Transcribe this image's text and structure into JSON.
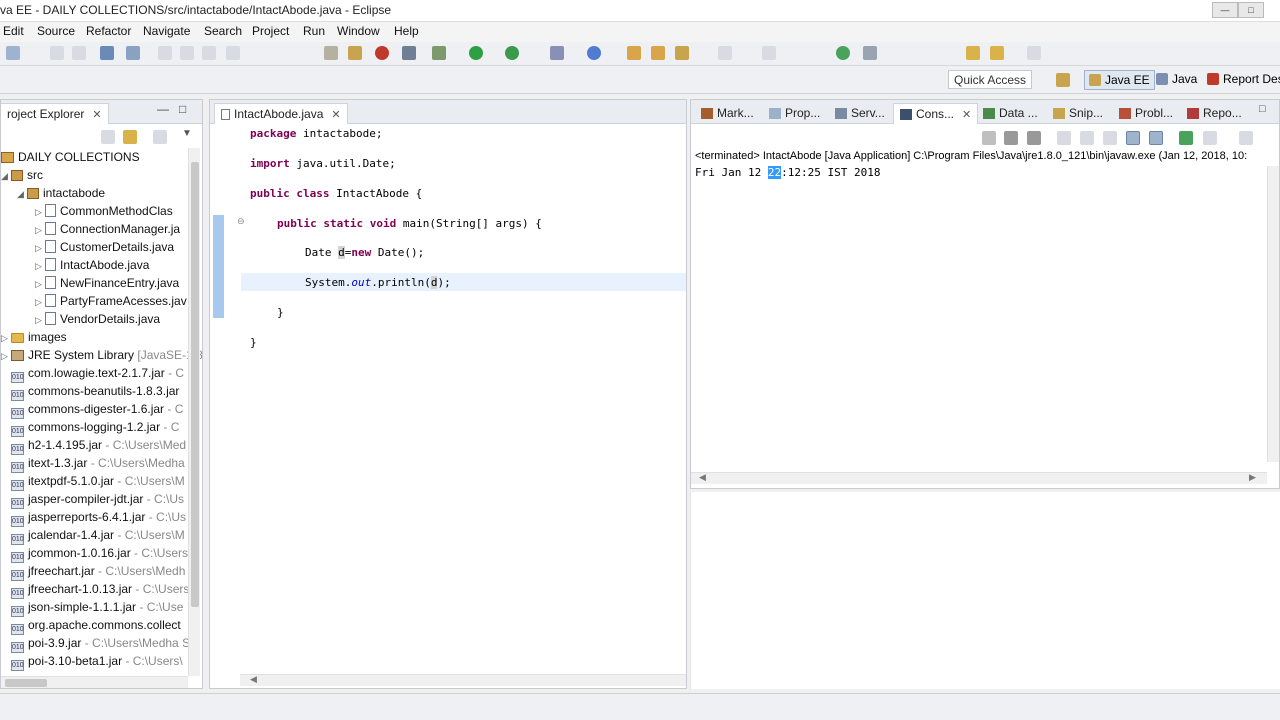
{
  "window": {
    "title": "va EE - DAILY COLLECTIONS/src/intactabode/IntactAbode.java - Eclipse"
  },
  "menu": [
    "Edit",
    "Source",
    "Refactor",
    "Navigate",
    "Search",
    "Project",
    "Run",
    "Window",
    "Help"
  ],
  "toolbar": {
    "quick_access": "Quick Access",
    "perspectives": [
      "Java EE",
      "Java",
      "Report Des"
    ]
  },
  "project_explorer": {
    "tab_label": "roject Explorer",
    "project": "DAILY COLLECTIONS",
    "src": "src",
    "package": "intactabode",
    "files": [
      "CommonMethodClas",
      "ConnectionManager.ja",
      "CustomerDetails.java",
      "IntactAbode.java",
      "NewFinanceEntry.java",
      "PartyFrameAcesses.jav",
      "VendorDetails.java"
    ],
    "images": "images",
    "jre": {
      "name": "JRE System Library",
      "path": "[JavaSE-1.8"
    },
    "jars": [
      {
        "name": "com.lowagie.text-2.1.7.jar",
        "path": " - C"
      },
      {
        "name": "commons-beanutils-1.8.3.jar",
        "path": ""
      },
      {
        "name": "commons-digester-1.6.jar",
        "path": " - C"
      },
      {
        "name": "commons-logging-1.2.jar",
        "path": " - C"
      },
      {
        "name": "h2-1.4.195.jar",
        "path": " - C:\\Users\\Med"
      },
      {
        "name": "itext-1.3.jar",
        "path": " - C:\\Users\\Medha"
      },
      {
        "name": "itextpdf-5.1.0.jar",
        "path": " - C:\\Users\\M"
      },
      {
        "name": "jasper-compiler-jdt.jar",
        "path": " - C:\\Us"
      },
      {
        "name": "jasperreports-6.4.1.jar",
        "path": " - C:\\Us"
      },
      {
        "name": "jcalendar-1.4.jar",
        "path": " - C:\\Users\\M"
      },
      {
        "name": "jcommon-1.0.16.jar",
        "path": " - C:\\Users"
      },
      {
        "name": "jfreechart.jar",
        "path": " - C:\\Users\\Medh"
      },
      {
        "name": "jfreechart-1.0.13.jar",
        "path": " - C:\\Users"
      },
      {
        "name": "json-simple-1.1.1.jar",
        "path": " - C:\\Use"
      },
      {
        "name": "org.apache.commons.collect",
        "path": ""
      },
      {
        "name": "poi-3.9.jar",
        "path": " - C:\\Users\\Medha S"
      },
      {
        "name": "poi-3.10-beta1.jar",
        "path": " - C:\\Users\\"
      }
    ]
  },
  "editor": {
    "tab_label": "IntactAbode.java",
    "lines": {
      "l1_kw": "package",
      "l1_rest": " intactabode;",
      "l2_kw": "import",
      "l2_rest": " java.util.Date;",
      "l3_kw": "public class",
      "l3_rest": " IntactAbode {",
      "l4_kw": "public static void",
      "l4_rest": " main(String[] args) {",
      "l5_a": "Date ",
      "l5_var": "d",
      "l5_eq": "=",
      "l5_kw": "new",
      "l5_rest": " Date();",
      "l6_a": "System.",
      "l6_it": "out",
      "l6_b": ".println(",
      "l6_var": "d",
      "l6_c": ");",
      "l7": "}",
      "l8": "}"
    }
  },
  "bottom_tabs": [
    "Mark...",
    "Prop...",
    "Serv...",
    "Cons...",
    "Data ...",
    "Snip...",
    "Probl...",
    "Repo..."
  ],
  "console": {
    "header": "<terminated> IntactAbode [Java Application] C:\\Program Files\\Java\\jre1.8.0_121\\bin\\javaw.exe (Jan 12, 2018, 10:",
    "out_a": "Fri Jan 12 ",
    "out_sel": "22",
    "out_b": ":12:25 IST 2018"
  }
}
